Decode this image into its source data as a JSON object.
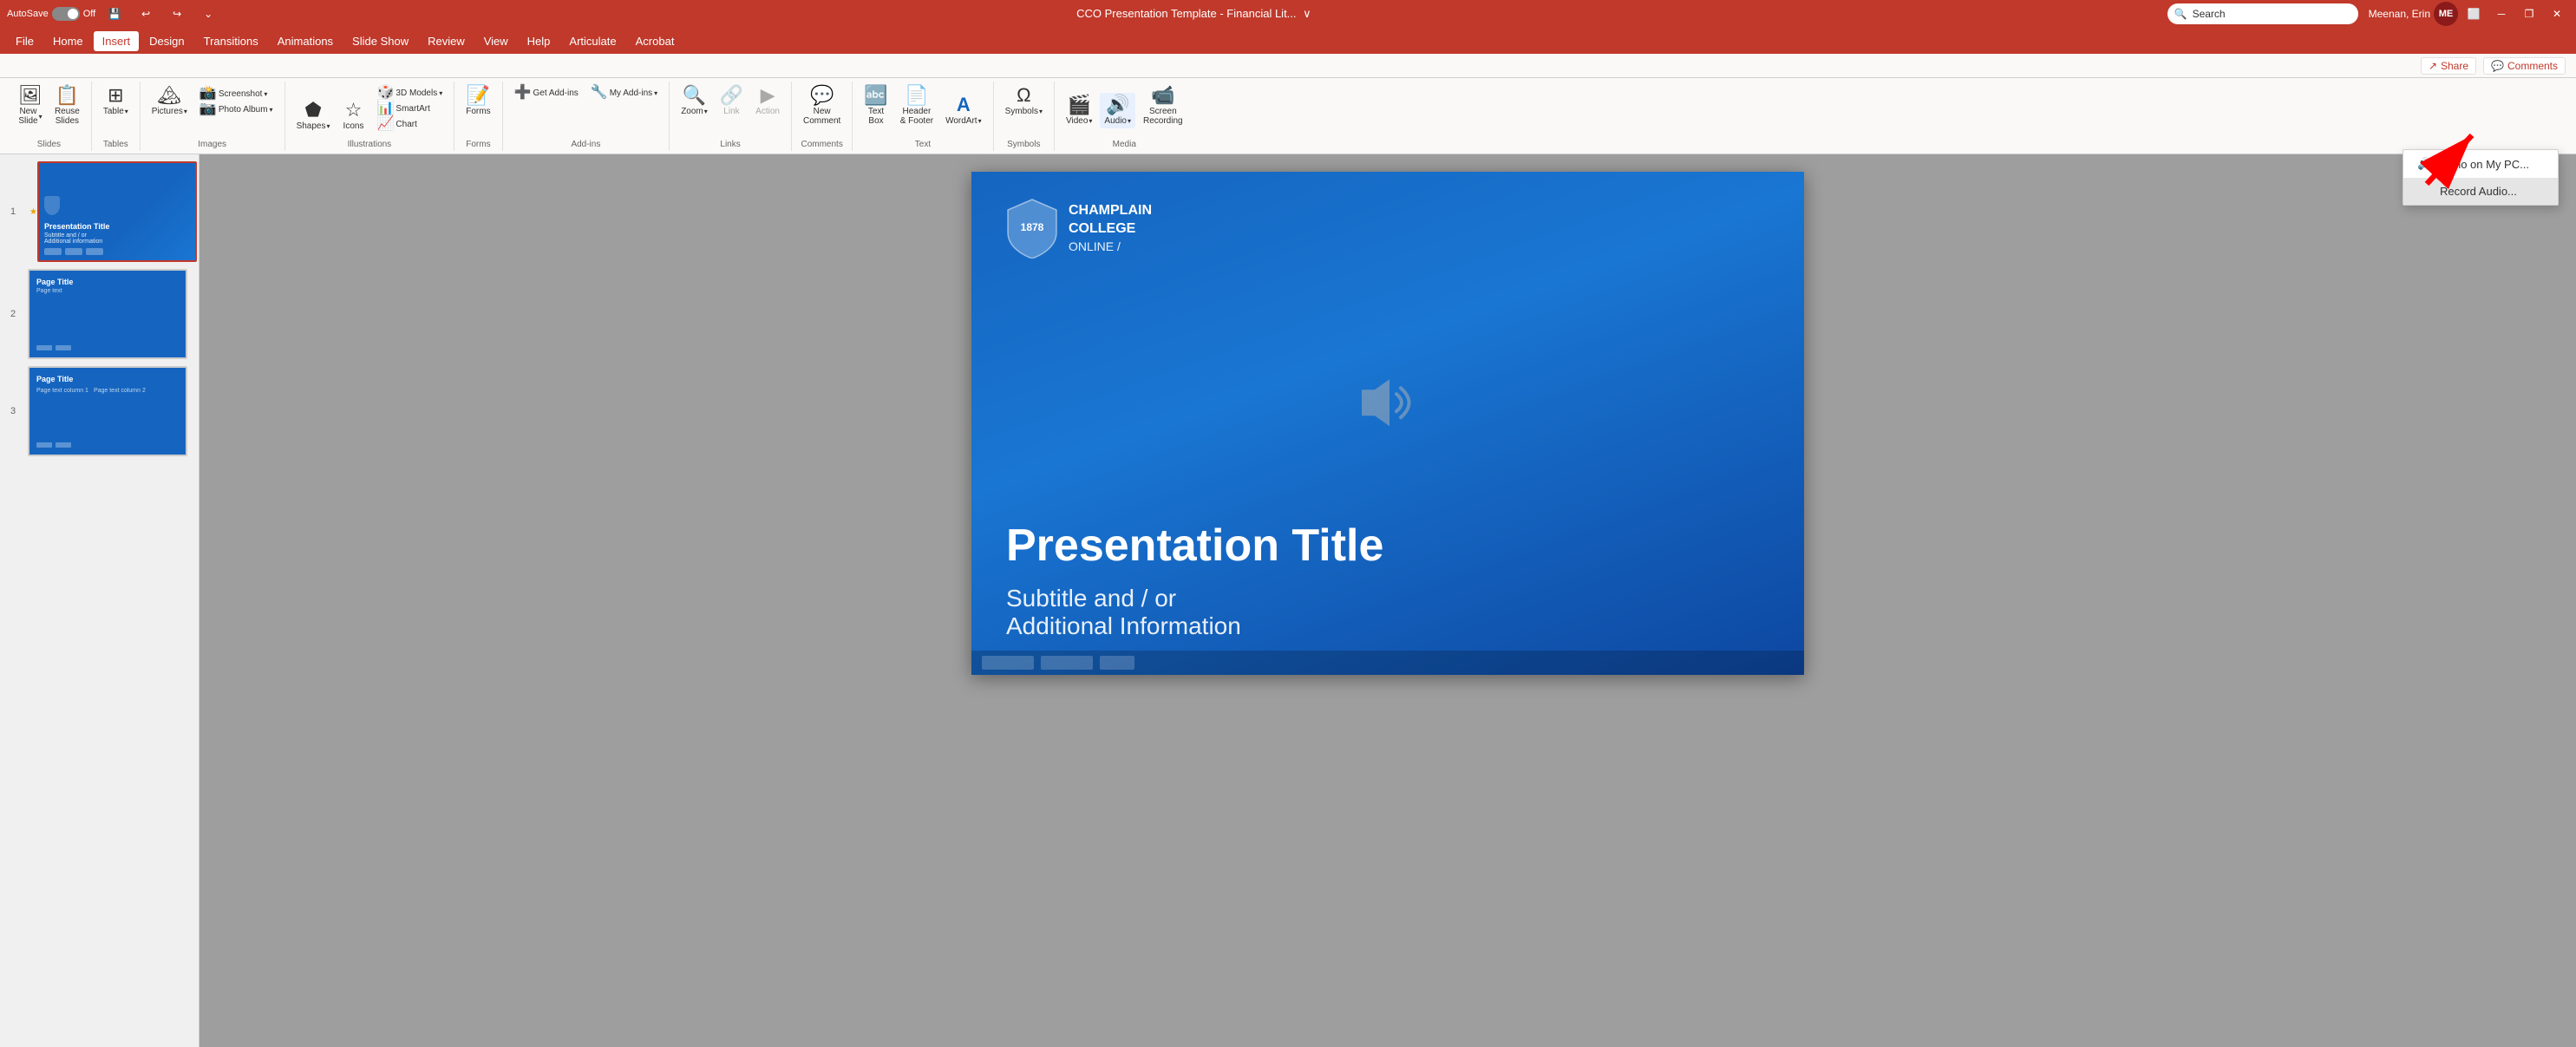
{
  "titlebar": {
    "autosave_label": "AutoSave",
    "autosave_state": "Off",
    "title": "CCO Presentation Template - Financial Lit...",
    "search_placeholder": "Search",
    "user_name": "Meenan, Erin",
    "user_initials": "ME",
    "minimize_icon": "─",
    "restore_icon": "❐",
    "close_icon": "✕"
  },
  "menubar": {
    "items": [
      "File",
      "Home",
      "Insert",
      "Design",
      "Transitions",
      "Animations",
      "Slide Show",
      "Review",
      "View",
      "Help",
      "Articulate",
      "Acrobat"
    ]
  },
  "ribbon": {
    "groups": [
      {
        "name": "Slides",
        "label": "Slides",
        "buttons": [
          {
            "id": "new-slide",
            "icon": "🖼",
            "label": "New\nSlide",
            "has_dropdown": true
          },
          {
            "id": "reuse-slides",
            "icon": "📋",
            "label": "Reuse\nSlides"
          }
        ]
      },
      {
        "name": "Tables",
        "label": "Tables",
        "buttons": [
          {
            "id": "table",
            "icon": "⊞",
            "label": "Table",
            "has_dropdown": true
          }
        ]
      },
      {
        "name": "Images",
        "label": "Images",
        "buttons": [
          {
            "id": "pictures",
            "icon": "🖼",
            "label": "Pictures",
            "has_dropdown": true
          },
          {
            "id": "screenshot",
            "icon": "📸",
            "label": "Screenshot",
            "has_dropdown": true
          },
          {
            "id": "photo-album",
            "icon": "📷",
            "label": "Photo Album",
            "has_dropdown": true
          }
        ]
      },
      {
        "name": "Illustrations",
        "label": "Illustrations",
        "buttons": [
          {
            "id": "shapes",
            "icon": "⬟",
            "label": "Shapes",
            "has_dropdown": true
          },
          {
            "id": "icons",
            "icon": "☆",
            "label": "Icons"
          },
          {
            "id": "3d-models",
            "icon": "🎲",
            "label": "3D Models",
            "has_dropdown": true
          },
          {
            "id": "smartart",
            "icon": "📊",
            "label": "SmartArt"
          },
          {
            "id": "chart",
            "icon": "📈",
            "label": "Chart"
          }
        ]
      },
      {
        "name": "Forms",
        "label": "Forms",
        "buttons": [
          {
            "id": "forms",
            "icon": "📝",
            "label": "Forms"
          }
        ]
      },
      {
        "name": "Add-ins",
        "label": "Add-ins",
        "buttons": [
          {
            "id": "get-addins",
            "icon": "➕",
            "label": "Get Add-ins"
          },
          {
            "id": "my-addins",
            "icon": "🔧",
            "label": "My Add-ins",
            "has_dropdown": true
          }
        ]
      },
      {
        "name": "Links",
        "label": "Links",
        "buttons": [
          {
            "id": "zoom",
            "icon": "🔍",
            "label": "Zoom",
            "has_dropdown": true
          },
          {
            "id": "link",
            "icon": "🔗",
            "label": "Link",
            "disabled": true
          },
          {
            "id": "action",
            "icon": "▶",
            "label": "Action",
            "disabled": true
          }
        ]
      },
      {
        "name": "Comments",
        "label": "Comments",
        "buttons": [
          {
            "id": "new-comment",
            "icon": "💬",
            "label": "New\nComment"
          }
        ]
      },
      {
        "name": "Text",
        "label": "Text",
        "buttons": [
          {
            "id": "text-box",
            "icon": "🔤",
            "label": "Text\nBox"
          },
          {
            "id": "header-footer",
            "icon": "📄",
            "label": "Header\n& Footer"
          },
          {
            "id": "wordart",
            "icon": "A",
            "label": "WordArt",
            "has_dropdown": true
          }
        ]
      },
      {
        "name": "Symbols",
        "label": "Symbols",
        "buttons": [
          {
            "id": "symbols",
            "icon": "Ω",
            "label": "Symbols",
            "has_dropdown": true
          }
        ]
      },
      {
        "name": "Media",
        "label": "Media",
        "buttons": [
          {
            "id": "video",
            "icon": "🎬",
            "label": "Video",
            "has_dropdown": true
          },
          {
            "id": "audio",
            "icon": "🔊",
            "label": "Audio",
            "has_dropdown": true,
            "active": true
          },
          {
            "id": "screen-recording",
            "icon": "📹",
            "label": "Screen\nRecording"
          }
        ]
      }
    ],
    "audio_dropdown": {
      "items": [
        {
          "id": "audio-on-pc",
          "icon": "🔊",
          "label": "Audio on My PC..."
        },
        {
          "id": "record-audio",
          "label": "Record Audio..."
        }
      ]
    }
  },
  "sharebar": {
    "share_label": "Share",
    "comments_label": "Comments"
  },
  "slides": [
    {
      "num": "1",
      "active": true,
      "has_star": true,
      "title": "Presentation Title",
      "subtitle": "Subtitle and / or\nAdditional information"
    },
    {
      "num": "2",
      "active": false,
      "has_star": false,
      "title": "Page Title",
      "text": "Page text"
    },
    {
      "num": "3",
      "active": false,
      "has_star": false,
      "title": "Page Title",
      "text": "Page text column 1    Page text column 2"
    }
  ],
  "slide_canvas": {
    "college_name": "CHAMPLAIN\nCOLLEGE\nONLINE /",
    "year": "1878",
    "main_title": "Presentation Title",
    "subtitle": "Subtitle and / or\nAdditional Information"
  }
}
